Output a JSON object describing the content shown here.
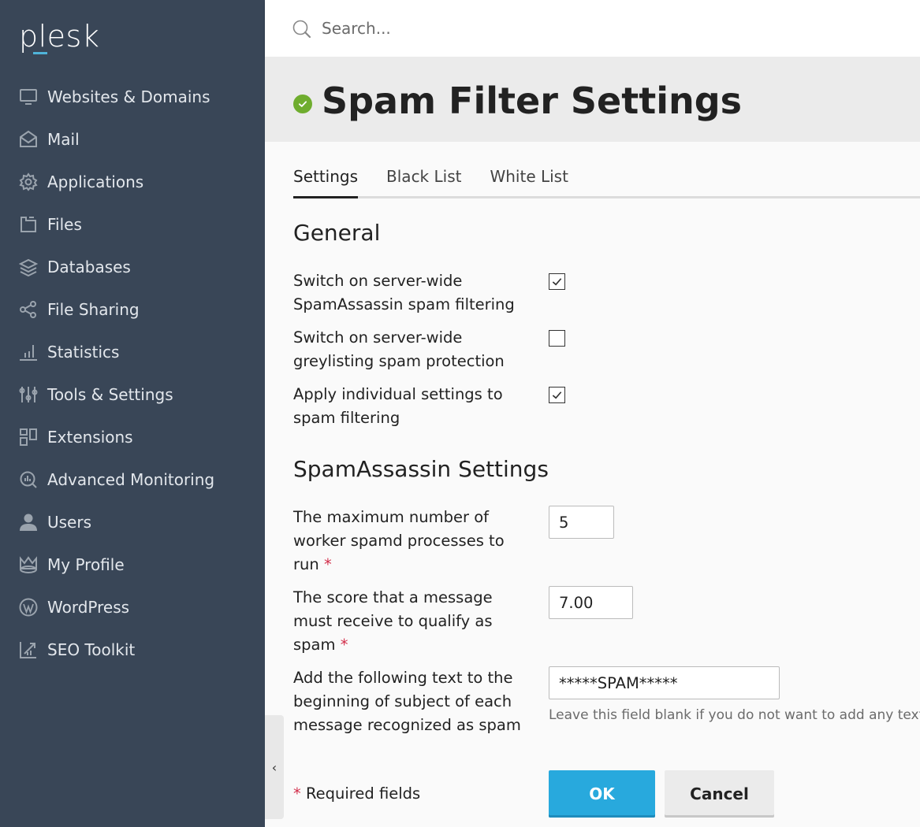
{
  "app": {
    "logo_text": "plesk"
  },
  "sidebar": {
    "items": [
      {
        "label": "Websites & Domains",
        "icon": "monitor-icon"
      },
      {
        "label": "Mail",
        "icon": "mail-icon"
      },
      {
        "label": "Applications",
        "icon": "gear-icon"
      },
      {
        "label": "Files",
        "icon": "folder-icon"
      },
      {
        "label": "Databases",
        "icon": "layers-icon"
      },
      {
        "label": "File Sharing",
        "icon": "share-icon"
      },
      {
        "label": "Statistics",
        "icon": "bar-chart-icon"
      },
      {
        "label": "Tools & Settings",
        "icon": "sliders-icon"
      },
      {
        "label": "Extensions",
        "icon": "extensions-icon"
      },
      {
        "label": "Advanced Monitoring",
        "icon": "monitoring-icon"
      },
      {
        "label": "Users",
        "icon": "user-icon"
      },
      {
        "label": "My Profile",
        "icon": "crown-icon"
      },
      {
        "label": "WordPress",
        "icon": "wordpress-icon"
      },
      {
        "label": "SEO Toolkit",
        "icon": "seo-chart-icon"
      }
    ],
    "collapse_glyph": "‹"
  },
  "search": {
    "placeholder": "Search...",
    "value": ""
  },
  "header": {
    "title": "Spam Filter Settings",
    "status_color": "#6fad2e"
  },
  "tabs": [
    {
      "label": "Settings",
      "active": true
    },
    {
      "label": "Black List",
      "active": false
    },
    {
      "label": "White List",
      "active": false
    }
  ],
  "general": {
    "title": "General",
    "options": [
      {
        "label": "Switch on server-wide SpamAssassin spam filtering",
        "checked": true
      },
      {
        "label": "Switch on server-wide greylisting spam protection",
        "checked": false
      },
      {
        "label": "Apply individual settings to spam filtering",
        "checked": true
      }
    ]
  },
  "spamassassin": {
    "title": "SpamAssassin Settings",
    "max_workers": {
      "label": "The maximum number of worker spamd processes to run",
      "value": "5",
      "required_mark": "*"
    },
    "score": {
      "label": "The score that a message must receive to qualify as spam",
      "value": "7.00",
      "required_mark": "*"
    },
    "subject_prefix": {
      "label": "Add the following text to the beginning of subject of each message recognized as spam",
      "value": "*****SPAM*****",
      "hint": "Leave this field blank if you do not want to add any text."
    }
  },
  "footer": {
    "required_mark": "*",
    "required_note": "Required fields",
    "ok_label": "OK",
    "cancel_label": "Cancel",
    "ok_color": "#28a9dd"
  }
}
